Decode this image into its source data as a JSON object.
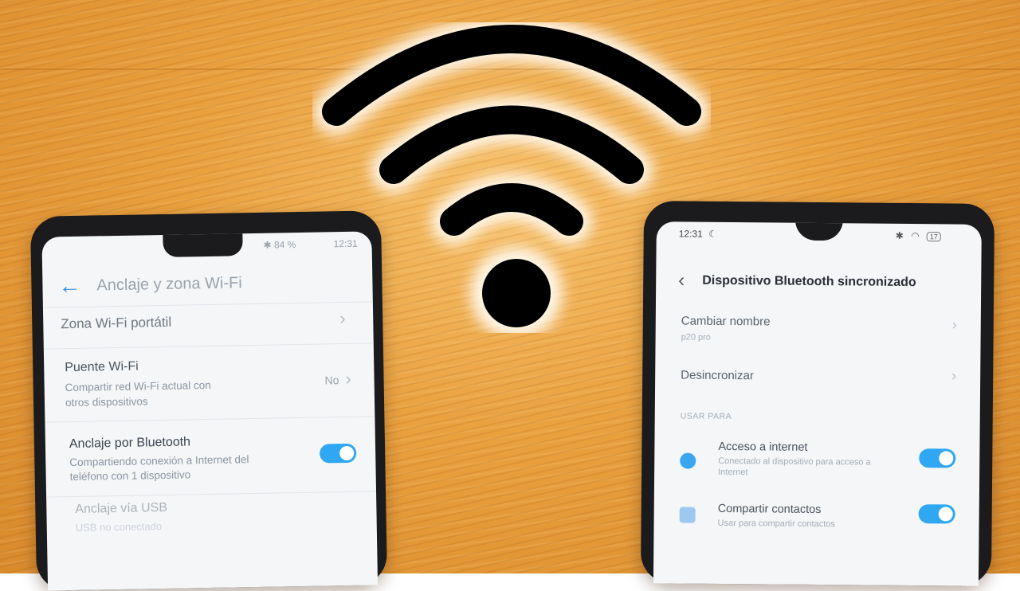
{
  "left_phone": {
    "status": {
      "battery": "84 %",
      "time": "12:31"
    },
    "title": "Anclaje y zona Wi-Fi",
    "rows": [
      {
        "title": "Zona Wi-Fi portátil"
      },
      {
        "title": "Puente Wi-Fi",
        "sub1": "Compartir red Wi-Fi actual con",
        "sub2": "otros dispositivos",
        "value": "No"
      },
      {
        "title": "Anclaje por Bluetooth",
        "sub1": "Compartiendo conexión a Internet del",
        "sub2": "teléfono con 1 dispositivo",
        "toggle": true
      },
      {
        "title": "Anclaje vía USB",
        "sub1": "USB no conectado"
      }
    ]
  },
  "right_phone": {
    "status": {
      "time": "12:31",
      "battery": "17"
    },
    "title": "Dispositivo Bluetooth sincronizado",
    "rows": [
      {
        "title": "Cambiar nombre",
        "sub": "p20 pro"
      },
      {
        "title": "Desincronizar"
      }
    ],
    "section_header": "USAR PARA",
    "toggles": [
      {
        "title": "Acceso a internet",
        "sub1": "Conectado al dispositivo para acceso a",
        "sub2": "Internet",
        "on": true
      },
      {
        "title": "Compartir contactos",
        "sub1": "Usar para compartir contactos",
        "on": true
      }
    ]
  },
  "colors": {
    "accent": "#2fa7f3",
    "wood": "#e9a03e",
    "wifi": "#000000"
  }
}
